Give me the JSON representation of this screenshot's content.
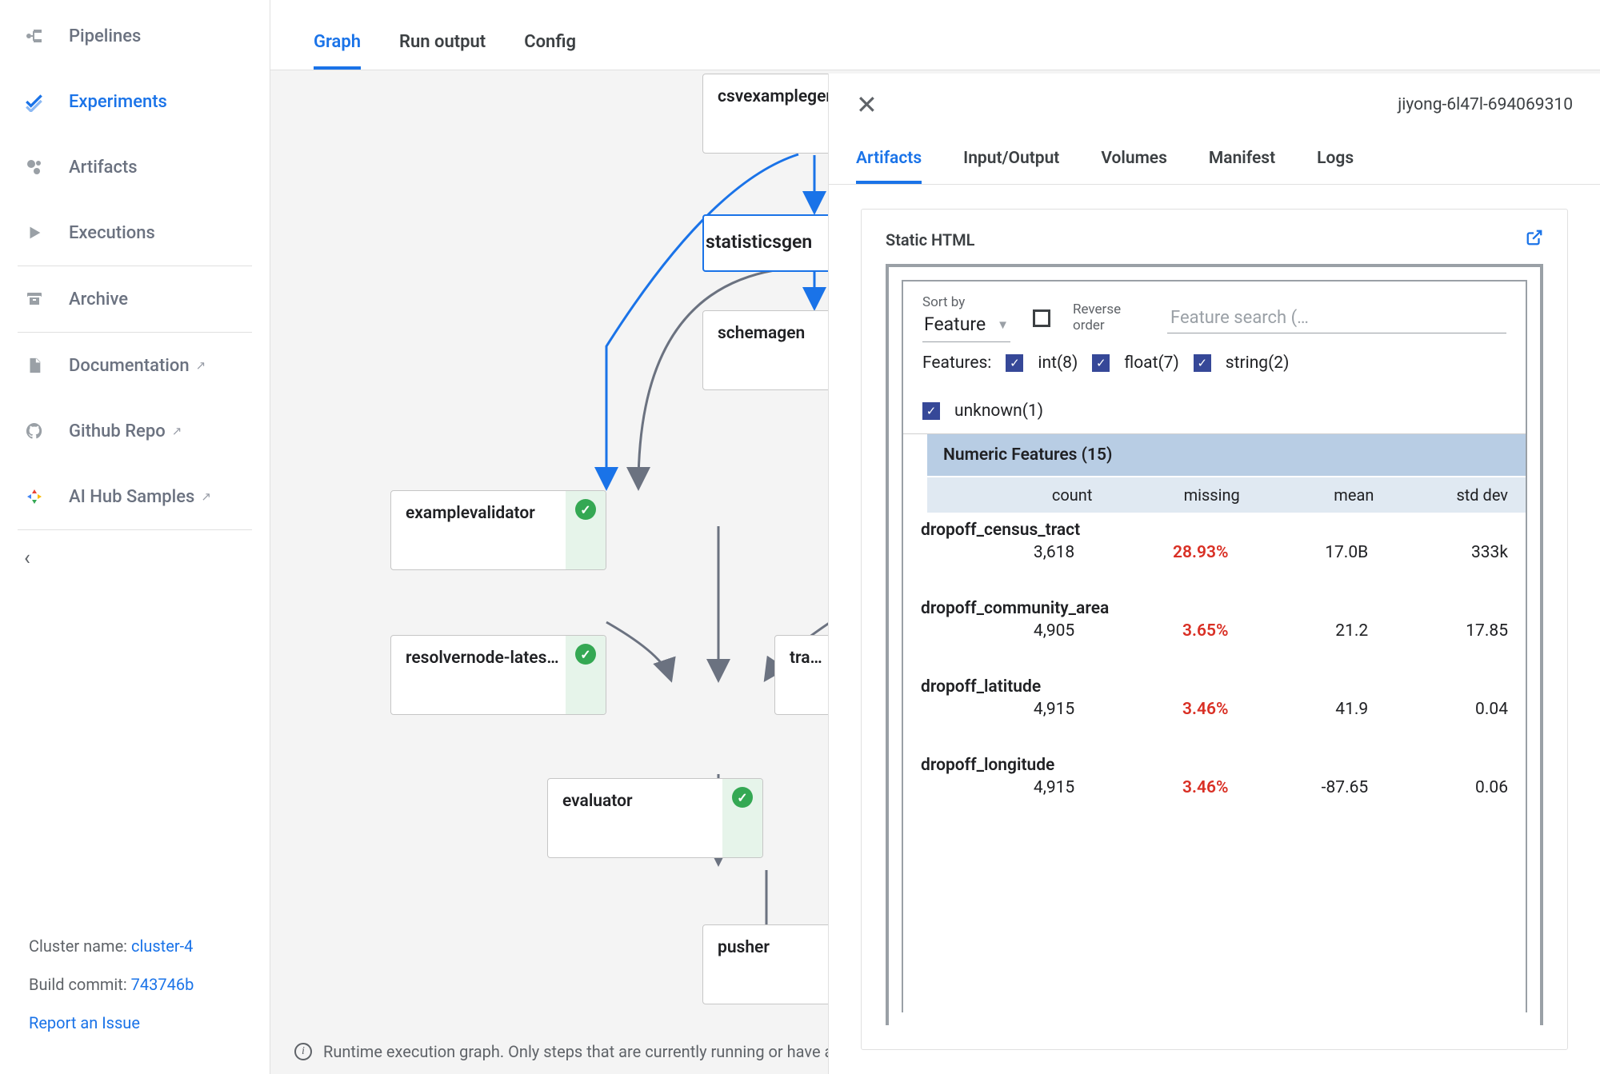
{
  "sidebar": {
    "items": [
      {
        "label": "Pipelines",
        "icon": "pipeline"
      },
      {
        "label": "Experiments",
        "icon": "experiments",
        "active": true
      },
      {
        "label": "Artifacts",
        "icon": "artifacts"
      },
      {
        "label": "Executions",
        "icon": "play"
      }
    ],
    "items2": [
      {
        "label": "Archive",
        "icon": "archive"
      }
    ],
    "items3": [
      {
        "label": "Documentation",
        "icon": "doc",
        "ext": true
      },
      {
        "label": "Github Repo",
        "icon": "github",
        "ext": true
      },
      {
        "label": "AI Hub Samples",
        "icon": "aihub",
        "ext": true
      }
    ],
    "footer": {
      "cluster_label": "Cluster name: ",
      "cluster_name": "cluster-4",
      "build_label": "Build commit: ",
      "build_val": "743746b",
      "report": "Report an Issue"
    }
  },
  "tabs": [
    "Graph",
    "Run output",
    "Config"
  ],
  "active_tab": 0,
  "nodes": {
    "csvexamplegen": "csvexamplegen",
    "statisticsgen": "statisticsgen",
    "schemagen": "schemagen",
    "examplevalidator": "examplevalidator",
    "resolvernode": "resolvernode-lates…",
    "trainer": "train",
    "evaluator": "evaluator",
    "pusher": "pusher"
  },
  "footnote": "Runtime execution graph. Only steps that are currently running or have a",
  "panel": {
    "run_id": "jiyong-6l47l-694069310",
    "tabs": [
      "Artifacts",
      "Input/Output",
      "Volumes",
      "Manifest",
      "Logs"
    ],
    "active_tab": 0,
    "card_title": "Static HTML",
    "sort_label": "Sort by",
    "sort_value": "Feature",
    "reverse_label": "Reverse order",
    "search_placeholder": "Feature search (…",
    "features_label": "Features:",
    "feature_types": [
      "int(8)",
      "float(7)",
      "string(2)",
      "unknown(1)"
    ],
    "table_title": "Numeric Features (15)",
    "columns": [
      "count",
      "missing",
      "mean",
      "std dev"
    ],
    "rows": [
      {
        "name": "dropoff_census_tract",
        "count": "3,618",
        "missing": "28.93%",
        "mean": "17.0B",
        "std": "333k"
      },
      {
        "name": "dropoff_community_area",
        "count": "4,905",
        "missing": "3.65%",
        "mean": "21.2",
        "std": "17.85"
      },
      {
        "name": "dropoff_latitude",
        "count": "4,915",
        "missing": "3.46%",
        "mean": "41.9",
        "std": "0.04"
      },
      {
        "name": "dropoff_longitude",
        "count": "4,915",
        "missing": "3.46%",
        "mean": "-87.65",
        "std": "0.06"
      }
    ]
  }
}
